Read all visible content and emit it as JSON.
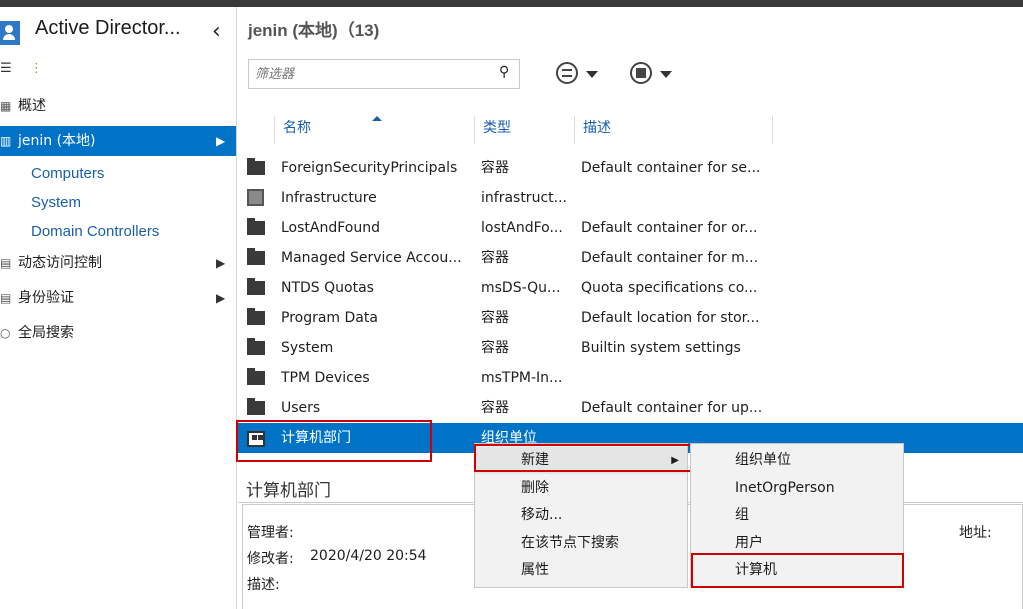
{
  "app": {
    "title": "Active Director..."
  },
  "nav": {
    "overview": "概述",
    "domain": "jenin (本地)",
    "subitems": [
      "Computers",
      "System",
      "Domain Controllers"
    ],
    "dynamic_access": "动态访问控制",
    "auth": "身份验证",
    "global_search": "全局搜索"
  },
  "main": {
    "header": "jenin (本地)（13)",
    "filter_placeholder": "筛选器",
    "columns": [
      "名称",
      "类型",
      "描述"
    ],
    "rows": [
      {
        "name": "ForeignSecurityPrincipals",
        "type": "容器",
        "desc": "Default container for se..."
      },
      {
        "name": "Infrastructure",
        "type": "infrastruct...",
        "desc": ""
      },
      {
        "name": "LostAndFound",
        "type": "lostAndFo...",
        "desc": "Default container for or..."
      },
      {
        "name": "Managed Service Accou...",
        "type": "容器",
        "desc": "Default container for m..."
      },
      {
        "name": "NTDS Quotas",
        "type": "msDS-Qu...",
        "desc": "Quota specifications co..."
      },
      {
        "name": "Program Data",
        "type": "容器",
        "desc": "Default location for stor..."
      },
      {
        "name": "System",
        "type": "容器",
        "desc": "Builtin system settings"
      },
      {
        "name": "TPM Devices",
        "type": "msTPM-In...",
        "desc": ""
      },
      {
        "name": "Users",
        "type": "容器",
        "desc": "Default container for up..."
      },
      {
        "name": "计算机部门",
        "type": "组织单位",
        "desc": ""
      }
    ]
  },
  "detail": {
    "title": "计算机部门",
    "manager_label": "管理者:",
    "modified_label": "修改者:",
    "modified_value": "2020/4/20 20:54",
    "desc_label": "描述:",
    "address_label": "地址:"
  },
  "context_menu": {
    "items": [
      "新建",
      "删除",
      "移动...",
      "在该节点下搜索",
      "属性"
    ]
  },
  "submenu": {
    "items": [
      "组织单位",
      "InetOrgPerson",
      "组",
      "用户",
      "计算机"
    ]
  },
  "colors": {
    "selection": "#0073c6",
    "link": "#1a5fab",
    "highlight_box": "#d00000"
  }
}
